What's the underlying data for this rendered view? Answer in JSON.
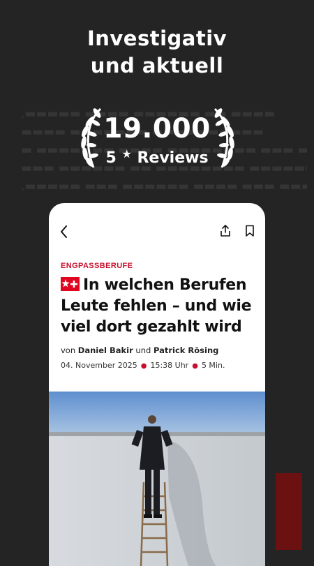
{
  "promo": {
    "headline_line1": "Investigativ",
    "headline_line2": "und aktuell"
  },
  "badge": {
    "count": "19.000",
    "label_prefix": "5",
    "label_suffix": "Reviews"
  },
  "article": {
    "kicker": "ENGPASSBERUFE",
    "title_line1": "In welchen Berufen",
    "title_line2": "Leute fehlen – und wie",
    "title_line3": "viel dort gezahlt wird",
    "byline_prefix": "von",
    "author1": "Daniel Bakir",
    "byline_and": "und",
    "author2": "Patrick Rösing",
    "date": "04. November 2025",
    "time": "15:38 Uhr",
    "read_time": "5 Min."
  },
  "icons": {
    "back": "chevron-left-icon",
    "share": "share-icon",
    "bookmark": "bookmark-icon",
    "plus_badge": "stern-plus-icon",
    "laurel": "laurel-wreath-icon",
    "star": "star-icon"
  },
  "colors": {
    "background": "#242424",
    "accent_red": "#c8102e",
    "plus_red": "#e0061f"
  }
}
